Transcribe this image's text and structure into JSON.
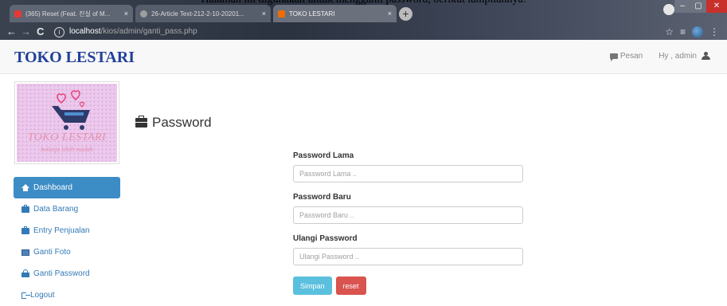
{
  "caption": "Halaman ini digunakan untuk mengganti password, berikut tampilannya:",
  "browser": {
    "tabs": [
      {
        "title": "(365) Reset (Feat. 진실 of M...",
        "fav_color": "#e53935"
      },
      {
        "title": "26-Article Text-212-2-10-20201...",
        "fav_color": "#9e9e9e"
      },
      {
        "title": "TOKO LESTARI",
        "fav_color": "#ef6c00"
      }
    ],
    "url_host": "localhost",
    "url_path": "/kios/admin/ganti_pass.php"
  },
  "navbar": {
    "brand": "TOKO LESTARI",
    "messages_label": "Pesan",
    "greeting": "Hy , admin"
  },
  "logo": {
    "name": "TOKO LESTARI",
    "tagline": "belanja lebih mudah"
  },
  "sidebar": {
    "items": [
      {
        "label": "Dashboard",
        "icon": "home-icon",
        "active": true
      },
      {
        "label": "Data Barang",
        "icon": "briefcase-icon",
        "active": false
      },
      {
        "label": "Entry Penjualan",
        "icon": "briefcase-icon",
        "active": false
      },
      {
        "label": "Ganti Foto",
        "icon": "picture-icon",
        "active": false
      },
      {
        "label": "Ganti Password",
        "icon": "lock-icon",
        "active": false
      },
      {
        "label": "Logout",
        "icon": "logout-icon",
        "active": false
      }
    ]
  },
  "main": {
    "title": "Password",
    "form": {
      "old_label": "Password Lama",
      "old_placeholder": "Password Lama ..",
      "new_label": "Password Baru",
      "new_placeholder": "Password Baru ..",
      "repeat_label": "Ulangi Password",
      "repeat_placeholder": "Ulangi Password ..",
      "save_label": "Simpan",
      "reset_label": "reset"
    }
  },
  "colors": {
    "brand": "#21409a",
    "active_menu": "#3c8dc5",
    "link": "#337ab7",
    "btn_info": "#5bc0de",
    "btn_danger": "#d9534f"
  }
}
